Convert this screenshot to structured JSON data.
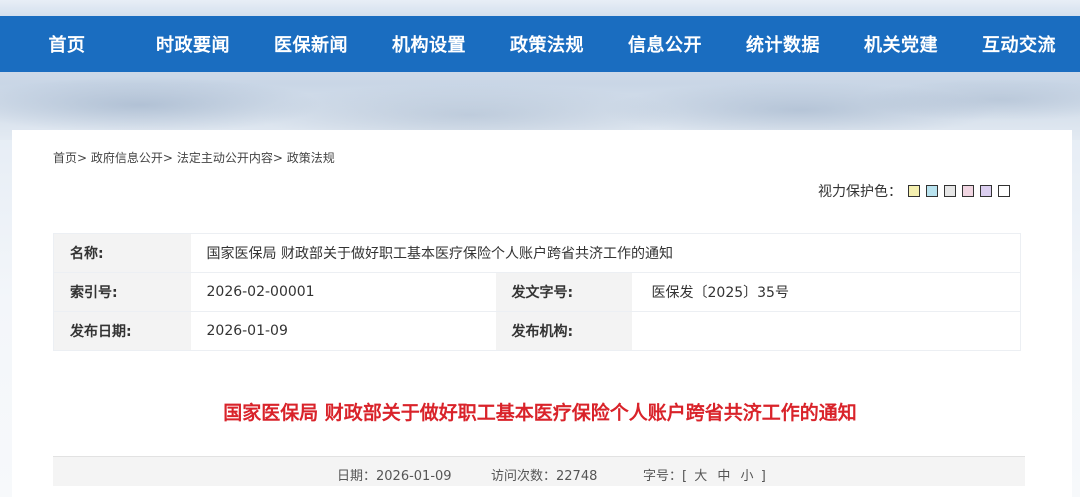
{
  "nav": {
    "items": [
      "首页",
      "时政要闻",
      "医保新闻",
      "机构设置",
      "政策法规",
      "信息公开",
      "统计数据",
      "机关党建",
      "互动交流"
    ]
  },
  "breadcrumb": {
    "items": [
      "首页",
      "政府信息公开",
      "法定主动公开内容",
      "政策法规"
    ],
    "separator": ">"
  },
  "eye_care": {
    "label": "视力保护色：",
    "colors": [
      "#f5f0b0",
      "#b9e3ef",
      "#e6e6e6",
      "#f1d6e2",
      "#dccff0",
      "#ffffff"
    ]
  },
  "meta": {
    "name_label": "名称:",
    "name_value": "国家医保局 财政部关于做好职工基本医疗保险个人账户跨省共济工作的通知",
    "index_label": "索引号:",
    "index_value": "2026-02-00001",
    "docno_label": "发文字号:",
    "docno_value": "医保发〔2025〕35号",
    "date_label": "发布日期:",
    "date_value": "2026-01-09",
    "org_label": "发布机构:",
    "org_value": ""
  },
  "document": {
    "title": "国家医保局 财政部关于做好职工基本医疗保险个人账户跨省共济工作的通知"
  },
  "info_bar": {
    "date_label": "日期：",
    "date_value": "2026-01-09",
    "visits_label": "访问次数：",
    "visits_value": "22748",
    "fontsize_label": "字号：",
    "fontsize_open": "[",
    "fontsize_large": "大",
    "fontsize_medium": "中",
    "fontsize_small": "小",
    "fontsize_close": "]"
  },
  "colors": {
    "nav_bg": "#1a6dc0",
    "title_red": "#d9232a"
  }
}
